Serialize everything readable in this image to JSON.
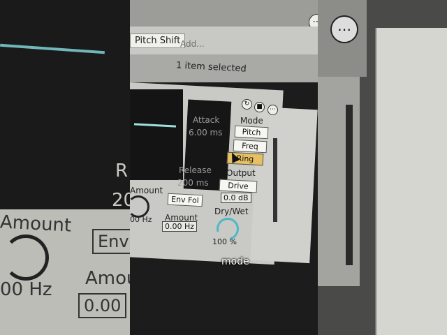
{
  "device": {
    "chip_label": "Pitch Shift",
    "add_placeholder": "Add...",
    "selection_text": "1 item selected",
    "attack_label": "Attack",
    "attack_value": "6.00 ms",
    "release_label": "Release",
    "release_value": "200 ms",
    "amount_label": "Amount",
    "amount_freq": "00 Hz",
    "env_fol_label": "Env Fol",
    "amount2_label": "Amount",
    "amount2_value": "0.00 Hz",
    "mode_label": "Mode",
    "mode_buttons": [
      "Pitch",
      "Freq",
      "Ring"
    ],
    "output_label": "Output",
    "drive_label": "Drive",
    "output_value": "0.0 dB",
    "drywet_label": "Dry/Wet",
    "drywet_value": "100 %"
  },
  "left_blur": {
    "amount_label": "Amount",
    "freq_label": "00 Hz",
    "env_label": "Env",
    "amo_label": "Amou",
    "value_label": "0.00",
    "r_label": "R",
    "num_label": "20"
  },
  "caption": "mode",
  "colors": {
    "active_button": "#e7c063",
    "knob": "#4cb8c8"
  }
}
